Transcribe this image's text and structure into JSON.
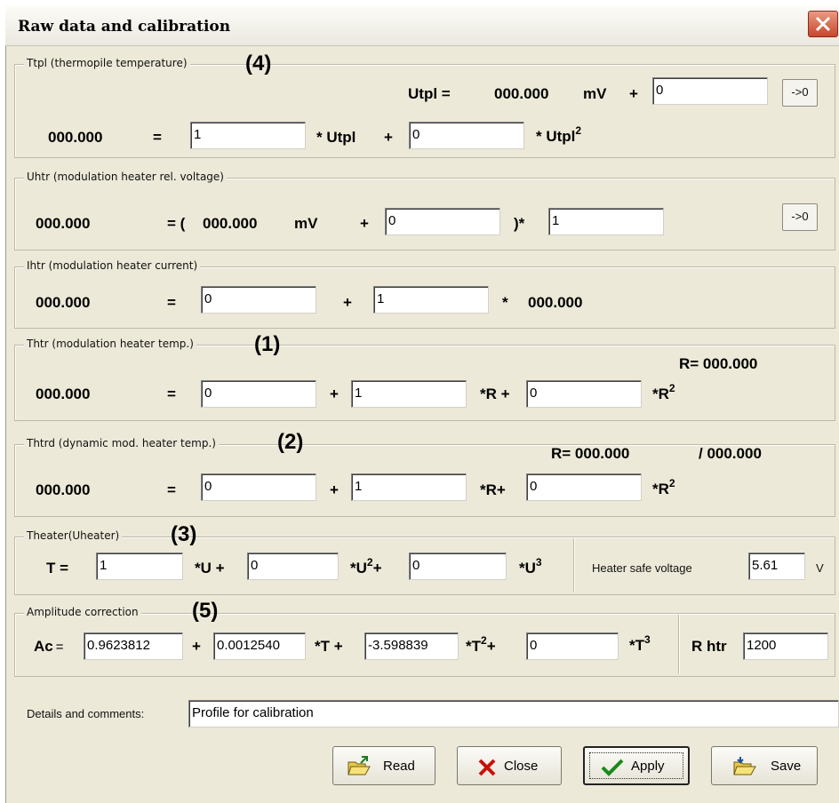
{
  "window": {
    "title": "Raw data and calibration"
  },
  "ttpl": {
    "label": "Ttpl (thermopile temperature)",
    "marker": "(4)",
    "utpl_label": "Utpl =",
    "utpl_value": "000.000",
    "unit_mv": "mV",
    "plus": "+",
    "offset": "0",
    "zero_btn": "->0",
    "result": "000.000",
    "eq": "=",
    "c1": "1",
    "mul_utpl": "* Utpl",
    "plus2": "+",
    "c2": "0",
    "mul_utpl2": "* Utpl",
    "sq": "2"
  },
  "uhtr": {
    "label": "Uhtr (modulation heater rel. voltage)",
    "result": "000.000",
    "eq_open": "= (",
    "value": "000.000",
    "unit": "mV",
    "plus": "+",
    "offset": "0",
    "close_mul": ")*",
    "factor": "1",
    "zero_btn": "->0"
  },
  "ihtr": {
    "label": "Ihtr (modulation heater current)",
    "result": "000.000",
    "eq": "=",
    "c0": "0",
    "plus": "+",
    "c1": "1",
    "mul": "*",
    "value": "000.000"
  },
  "thtr": {
    "label": "Thtr (modulation heater temp.)",
    "marker": "(1)",
    "r_label": "R= 000.000",
    "result": "000.000",
    "eq": "=",
    "c0": "0",
    "plus": "+",
    "c1": "1",
    "mul_r": "*R +",
    "c2": "0",
    "mul_r2": "*R",
    "sq": "2"
  },
  "thtrd": {
    "label": "Thtrd (dynamic mod. heater temp.)",
    "marker": "(2)",
    "r_label": "R= 000.000",
    "r_label2": "/ 000.000",
    "result": "000.000",
    "eq": "=",
    "c0": "0",
    "plus": "+",
    "c1": "1",
    "mul_r": "*R+",
    "c2": "0",
    "mul_r2": "*R",
    "sq": "2"
  },
  "theater": {
    "label": "Theater(Uheater)",
    "marker": "(3)",
    "t_eq": "T =",
    "c0": "1",
    "mul_u": "*U +",
    "c1": "0",
    "mul_u2": "*U",
    "sq": "2",
    "plus": "+",
    "c2": "0",
    "mul_u3": "*U",
    "cube": "3",
    "safe_label": "Heater safe voltage",
    "safe_value": "5.61",
    "safe_unit": "V"
  },
  "ampl": {
    "label": "Amplitude correction",
    "marker": "(5)",
    "ac_label": "Ac",
    "eq": "=",
    "c0": "0.9623812",
    "plus": "+",
    "c1": "0.0012540",
    "mul_t": "*T +",
    "c2": "-3.598839",
    "mul_t2": "*T",
    "sq": "2",
    "plus2": "+",
    "c3": "0",
    "mul_t3": "*T",
    "cube": "3",
    "rhtr_label": "R htr",
    "rhtr_value": "1200"
  },
  "details": {
    "label": "Details and comments:",
    "value": "Profile for calibration"
  },
  "buttons": {
    "read": "Read",
    "close": "Close",
    "apply": "Apply",
    "save": "Save"
  }
}
